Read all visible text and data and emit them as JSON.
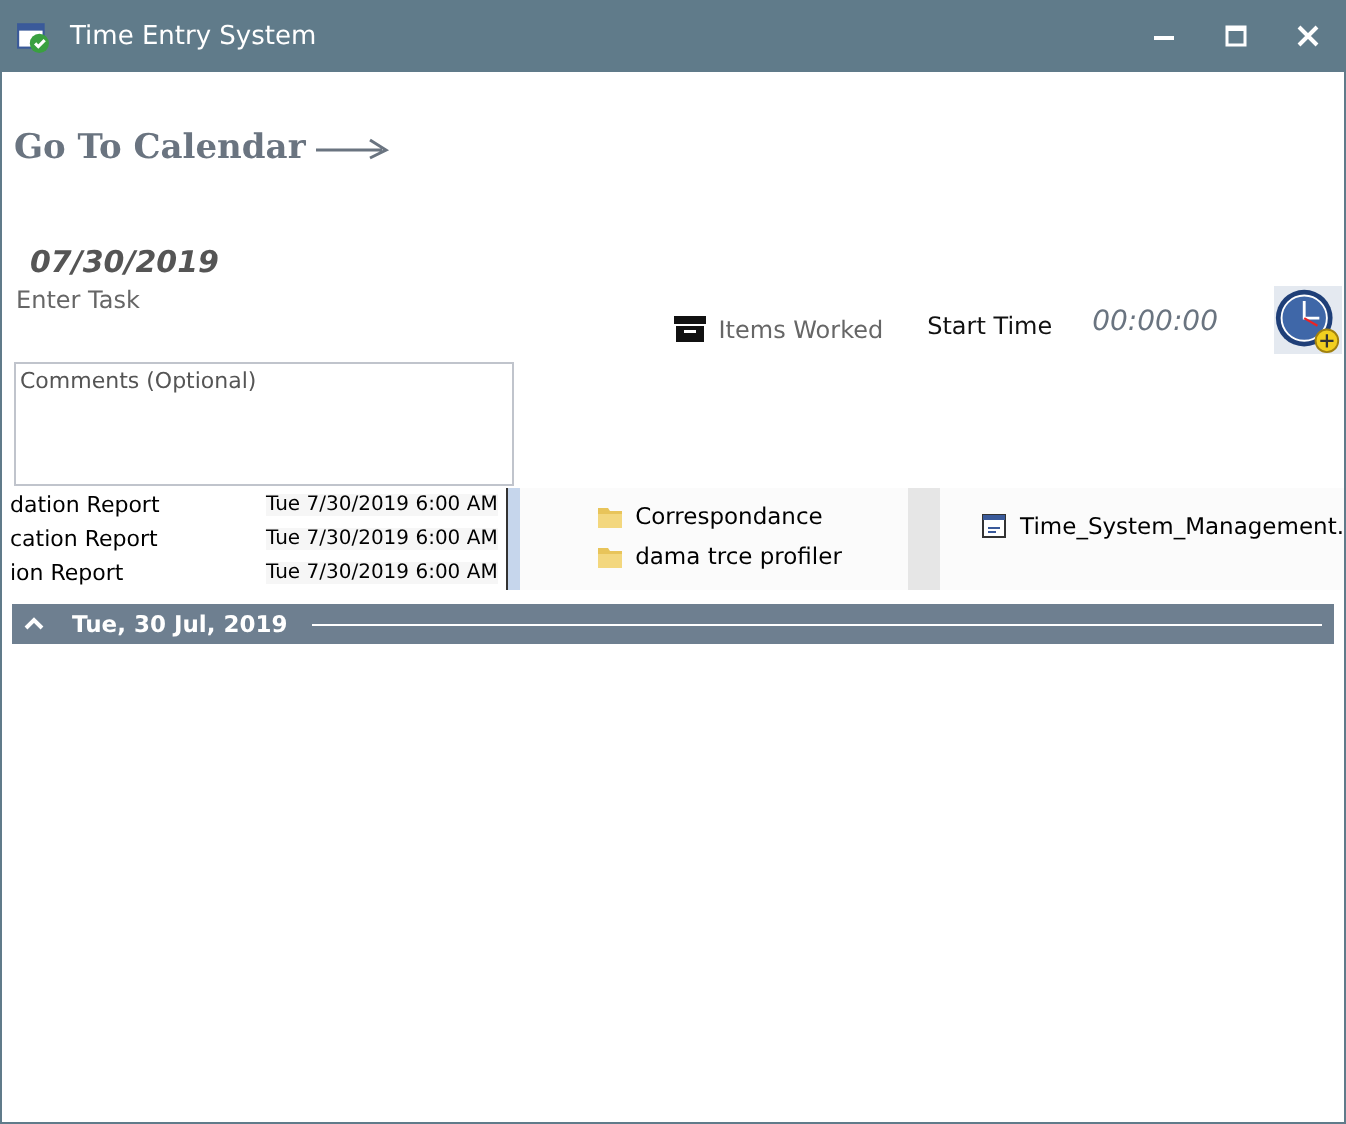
{
  "window": {
    "title": "Time Entry System"
  },
  "calendar_link": {
    "label": "Go To Calendar"
  },
  "date": "07/30/2019",
  "task": {
    "placeholder": "Enter Task"
  },
  "items_worked": {
    "label": "Items Worked"
  },
  "start_time": {
    "label": "Start Time",
    "value": "00:00:00"
  },
  "comments": {
    "placeholder": "Comments (Optional)"
  },
  "background_list": [
    {
      "name": "dation Report",
      "date": "Tue 7/30/2019 6:00 AM"
    },
    {
      "name": "cation Report",
      "date": "Tue 7/30/2019 6:00 AM"
    },
    {
      "name": "ion Report",
      "date": "Tue 7/30/2019 6:00 AM"
    }
  ],
  "folders": [
    {
      "name": "Correspondance"
    },
    {
      "name": "dama trce profiler"
    }
  ],
  "files": [
    {
      "name": "Time_System_Management."
    }
  ],
  "group_header": {
    "label": "Tue, 30 Jul, 2019",
    "expanded": true
  }
}
